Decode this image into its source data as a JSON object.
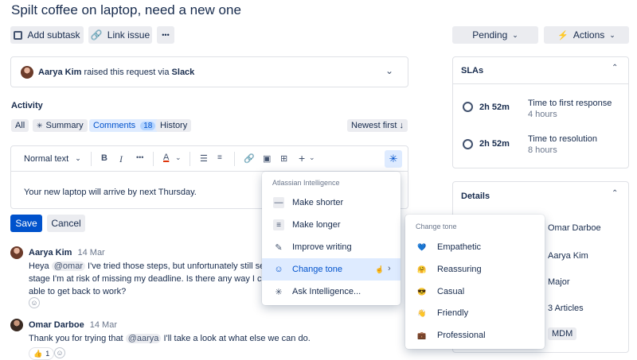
{
  "title": "Spilt coffee on laptop, need a new one",
  "toolbar": {
    "add_subtask": "Add subtask",
    "link_issue": "Link issue",
    "more": "•••",
    "status": "Pending",
    "actions": "Actions"
  },
  "request": {
    "name": "Aarya Kim",
    "text": "raised this request via",
    "channel": "Slack"
  },
  "activity": {
    "heading": "Activity",
    "tabs": {
      "all": "All",
      "summary": "Summary",
      "comments": "Comments",
      "comments_count": "18",
      "history": "History"
    },
    "sort": "Newest first ↓"
  },
  "editor": {
    "text_style": "Normal text",
    "content": "Your new laptop will arrive by next Thursday.",
    "save": "Save",
    "cancel": "Cancel"
  },
  "comments": [
    {
      "author": "Aarya Kim",
      "date": "14 Mar",
      "line1_prefix": "Heya",
      "mention": "@omar",
      "line1": "I've tried those steps, but unfortunately still seem",
      "line2": "stage I'm at risk of missing my deadline. Is there any way I can g",
      "line3": "able to get back to work?"
    },
    {
      "author": "Omar Darboe",
      "date": "14 Mar",
      "line1_prefix": "Thank you for trying that",
      "mention": "@aarya",
      "line1": "I'll take a look at what else we can do.",
      "reaction": "👍",
      "reaction_count": "1"
    }
  ],
  "ai_menu": {
    "header": "Atlassian Intelligence",
    "items": [
      {
        "label": "Make shorter",
        "icon": "minus-icon"
      },
      {
        "label": "Make longer",
        "icon": "lines-icon"
      },
      {
        "label": "Improve writing",
        "icon": "pencil-icon"
      },
      {
        "label": "Change tone",
        "icon": "smiley-icon"
      },
      {
        "label": "Ask Intelligence...",
        "icon": "sparkle-icon"
      }
    ]
  },
  "tone_menu": {
    "header": "Change tone",
    "items": [
      {
        "label": "Empathetic",
        "icon": "💙"
      },
      {
        "label": "Reassuring",
        "icon": "🤗"
      },
      {
        "label": "Casual",
        "icon": "😎"
      },
      {
        "label": "Friendly",
        "icon": "👋"
      },
      {
        "label": "Professional",
        "icon": "💼"
      }
    ]
  },
  "slas": {
    "heading": "SLAs",
    "items": [
      {
        "time": "2h 52m",
        "label": "Time to first response",
        "sub": "4 hours"
      },
      {
        "time": "2h 52m",
        "label": "Time to resolution",
        "sub": "8 hours"
      }
    ]
  },
  "details": {
    "heading": "Details",
    "values": [
      "Omar Darboe",
      "Aarya Kim",
      "Major",
      "3 Articles",
      "MDM"
    ]
  },
  "colors": {
    "primary": "#0052cc",
    "highlight": "#deebff",
    "neutral_bg": "#ebecf0"
  }
}
